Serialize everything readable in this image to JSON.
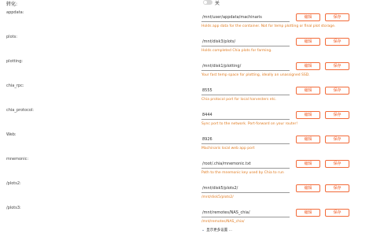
{
  "header": {
    "label": "转化:",
    "toggle_label": "关",
    "toggle_on": false
  },
  "rows": [
    {
      "label": "appdata:",
      "value": "/mnt/user/appdata/machinaris",
      "hint": "Holds app data for the container. Not for temp plotting or final plot storage.",
      "edit": "编辑",
      "save": "保存"
    },
    {
      "label": "plots:",
      "value": "/mnt/disk3/plots/",
      "hint": "Holds completed Chia plots for farming.",
      "edit": "编辑",
      "save": "保存"
    },
    {
      "label": "plotting:",
      "value": "/mnt/disk1/plotting/",
      "hint": "Your fast temp space for plotting, ideally an unassigned SSD.",
      "edit": "编辑",
      "save": "保存"
    },
    {
      "label": "chia_rpc:",
      "value": "8555",
      "hint": "Chia protocol port for local harvesters etc.",
      "edit": "编辑",
      "save": "保存"
    },
    {
      "label": "chia_protocol:",
      "value": "8444",
      "hint": "Sync port to the network. Port-forward on your router!",
      "edit": "编辑",
      "save": "保存"
    },
    {
      "label": "Web:",
      "value": "8926",
      "hint": "Machinaris local web app port",
      "edit": "编辑",
      "save": "保存"
    },
    {
      "label": "mnemonic:",
      "value": "/root/.chia/mnemonic.txt",
      "hint": "Path to the mnemonic key used by Chia to run",
      "edit": "编辑",
      "save": "保存"
    },
    {
      "label": "/plots2:",
      "value": "/mnt/disk5/plots2/",
      "hint": "/mnt/disk5/plots2/",
      "edit": "编辑",
      "save": "保存"
    },
    {
      "label": "/plots3:",
      "value": "/mnt/remotes/NAS_chia/",
      "hint": "/mnt/remotes/NAS_chia/",
      "edit": "编辑",
      "save": "保存"
    }
  ],
  "footer": {
    "label": "显示更多设置 ...",
    "icon": "chevron-down-icon"
  }
}
